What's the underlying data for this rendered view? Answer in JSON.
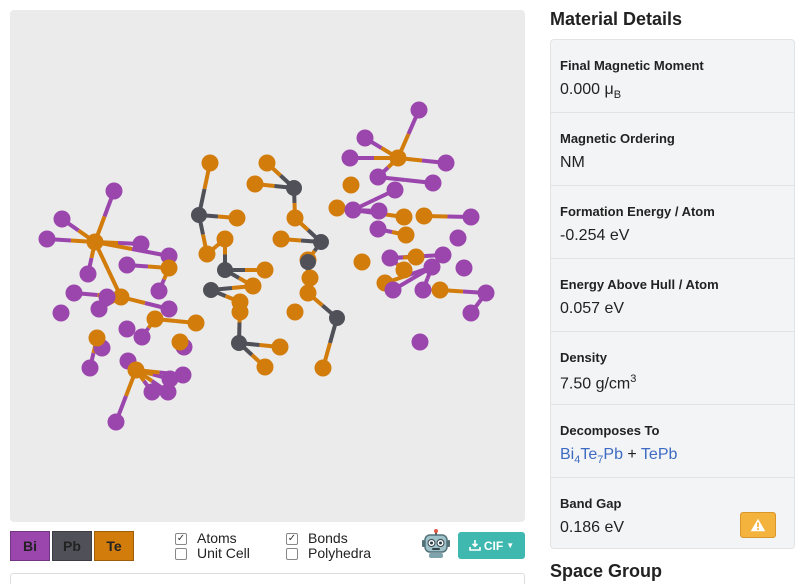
{
  "viewer": {
    "legend": [
      {
        "symbol": "Bi",
        "color": "#9a46ad"
      },
      {
        "symbol": "Pb",
        "color": "#505058"
      },
      {
        "symbol": "Te",
        "color": "#d27c0c"
      }
    ],
    "toggles": {
      "atoms": {
        "label": "Atoms",
        "checked": true
      },
      "unit_cell": {
        "label": "Unit Cell",
        "checked": false
      },
      "bonds": {
        "label": "Bonds",
        "checked": true
      },
      "polyhedra": {
        "label": "Polyhedra",
        "checked": false
      }
    },
    "download_label": "CIF"
  },
  "details": {
    "title": "Material Details",
    "properties": {
      "magnetic_moment": {
        "label": "Final Magnetic Moment",
        "value": "0.000 μ",
        "unit_sub": "B"
      },
      "magnetic_ordering": {
        "label": "Magnetic Ordering",
        "value": "NM"
      },
      "formation_energy": {
        "label": "Formation Energy / Atom",
        "value": "-0.254 eV"
      },
      "energy_above_hull": {
        "label": "Energy Above Hull / Atom",
        "value": "0.057 eV"
      },
      "density": {
        "label": "Density",
        "value": "7.50 g/cm",
        "unit_sup": "3"
      },
      "decomposes_to": {
        "label": "Decomposes To",
        "product1": {
          "p1": "Bi",
          "s1": "4",
          "p2": "Te",
          "s2": "7",
          "p3": "Pb"
        },
        "plus": "+",
        "product2": "TePb"
      },
      "band_gap": {
        "label": "Band Gap",
        "value": "0.186 eV"
      }
    },
    "next_section": "Space Group"
  }
}
